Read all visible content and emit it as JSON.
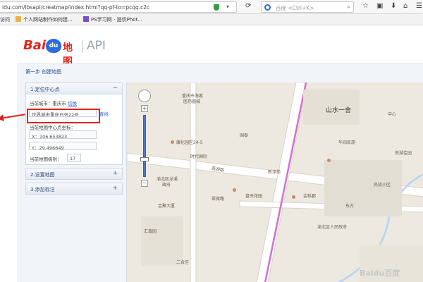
{
  "browser": {
    "url": "idu.com/lbsapi/creatmap/index.html?qq-pf-to=pcqq.c2c",
    "search_placeholder": "百度 <Ctrl+K>",
    "bookmarks": [
      "访问",
      "个人网站制作如何建...",
      "PS学习网 - 提供Phot..."
    ]
  },
  "header": {
    "logo_bai": "Bai",
    "logo_du": "du",
    "logo_ditu": "地图",
    "logo_api": "API"
  },
  "breadcrumb": "第一步 创建地图",
  "panel": {
    "section1": {
      "title": "1.定位中心点",
      "toggle": "−",
      "city_label": "当前城市：重庆市",
      "city_switch": "切换",
      "search_value": "世界城市重庆日号22号",
      "search_button": "查找",
      "center_label": "当前地图中心点坐标：",
      "x_value": "X：106.653823",
      "y_value": "Y：29.496649",
      "zoom_label": "当前地图级别：",
      "zoom_value": "17"
    },
    "section2": {
      "title": "2.设置地图",
      "toggle": "+"
    },
    "section3": {
      "title": "3.添加标注",
      "toggle": "+"
    }
  },
  "map": {
    "labels": [
      "重庆市海客",
      "医药器械",
      "山水一舍",
      "国泰",
      "华润凯旋",
      "中心",
      "南湖佳园",
      "康化园区24-5",
      "时代国际",
      "新泽苑",
      "莲湖路",
      "渝北区龙溪",
      "政府",
      "金聚大厦",
      "盘天花园",
      "金科郡",
      "东方",
      "二合区",
      "汇鑫园",
      "渝北区人民政府",
      "翠微路",
      "民族小区"
    ],
    "watermark": "Baidu百度"
  }
}
